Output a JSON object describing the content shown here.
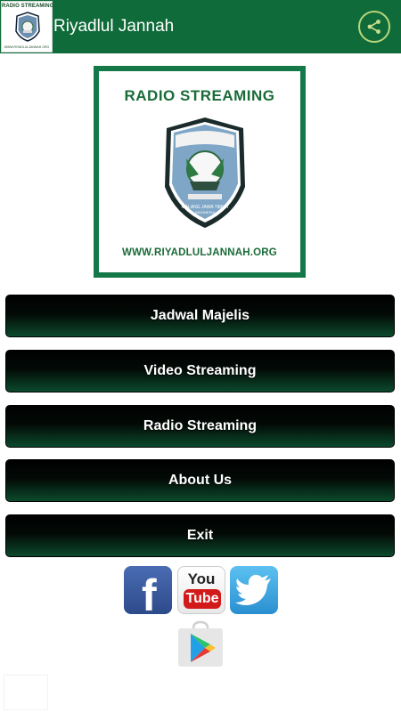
{
  "appbar": {
    "title": "Riyadlul Jannah",
    "icon_label_top": "RADIO STREAMING",
    "icon_label_bottom": "WWW.RIYADLULJANNAH.ORG",
    "share_icon": "share-icon",
    "color": "#0f6b3a"
  },
  "banner": {
    "title": "RADIO STREAMING",
    "url": "WWW.RIYADLULJANNAH.ORG",
    "border_color": "#147847"
  },
  "menu": [
    {
      "label": "Jadwal Majelis"
    },
    {
      "label": "Video Streaming"
    },
    {
      "label": "Radio Streaming"
    },
    {
      "label": "About Us"
    },
    {
      "label": "Exit"
    }
  ],
  "social": {
    "facebook_glyph": "f",
    "youtube_you": "You",
    "youtube_tube": "Tube"
  }
}
